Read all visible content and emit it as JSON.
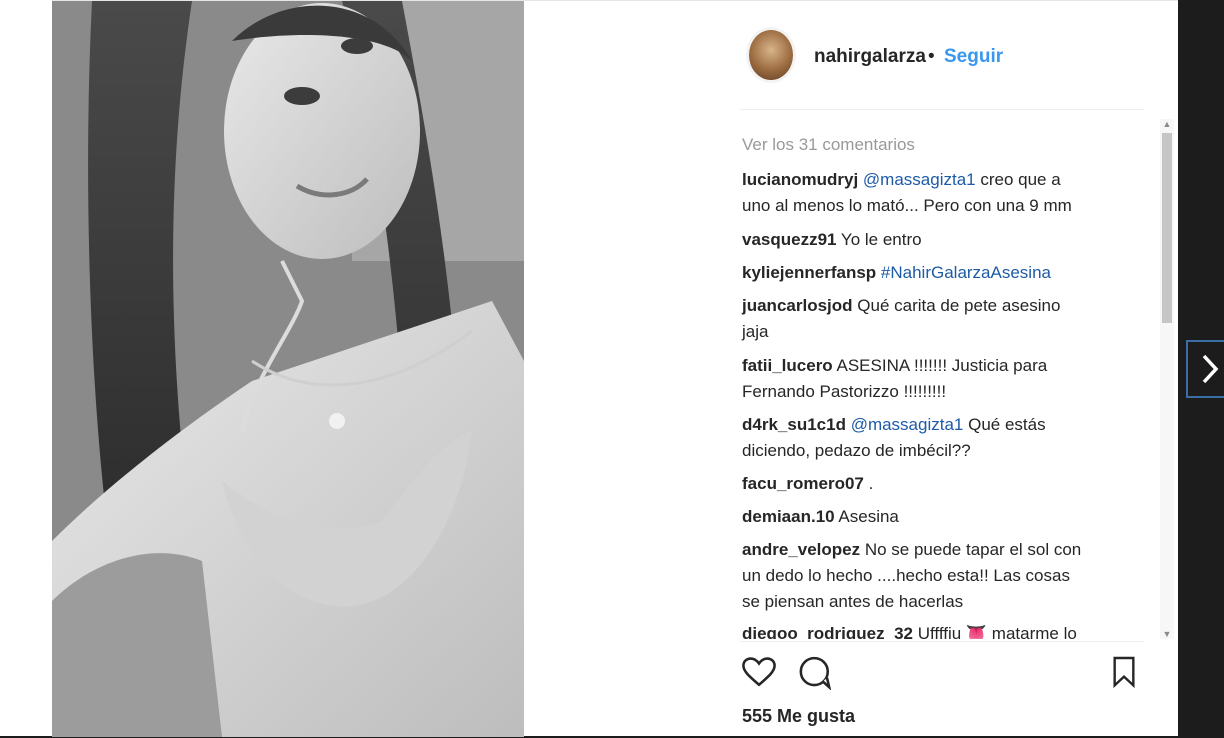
{
  "post": {
    "username": "nahirgalarza",
    "separator": "•",
    "follow_label": "Seguir",
    "view_all_comments": "Ver los 31 comentarios",
    "comments": [
      {
        "user": "lucianomudryj",
        "mention": "@massagizta1",
        "text": " creo que a",
        "text2": "uno al menos lo mató... Pero con una 9 mm"
      },
      {
        "user": "vasquezz91",
        "text": "Yo le entro"
      },
      {
        "user": "kyliejennerfansp",
        "mention": "#NahirGalarzaAsesina"
      },
      {
        "user": "juancarlosjod",
        "text": "Qué carita de pete asesino",
        "text2": "jaja"
      },
      {
        "user": "fatii_lucero",
        "text": "ASESINA !!!!!!! Justicia para",
        "text2": "Fernando Pastorizzo !!!!!!!!!"
      },
      {
        "user": "d4rk_su1c1d",
        "mention": "@massagizta1",
        "text": " Qué estás",
        "text2": "diciendo, pedazo de imbécil??"
      },
      {
        "user": "facu_romero07",
        "text": "."
      },
      {
        "user": "demiaan.10",
        "text": "Asesina"
      },
      {
        "user": "andre_velopez",
        "text": "No se puede tapar el sol con",
        "text2": "un dedo lo hecho ....hecho esta!! Las cosas",
        "text3": "se piensan antes de hacerlas"
      },
      {
        "user": "diegoo_rodriguez_32",
        "text": "Uffffiu 👅 matarme lo"
      }
    ],
    "likes": "555 Me gusta"
  },
  "icons": {
    "like": "heart-icon",
    "comment": "comment-bubble-icon",
    "save": "bookmark-icon",
    "next": "chevron-right-icon"
  },
  "colors": {
    "link": "#3897f0",
    "mention": "#1e5ba6",
    "text": "#262626",
    "muted": "#999999"
  }
}
